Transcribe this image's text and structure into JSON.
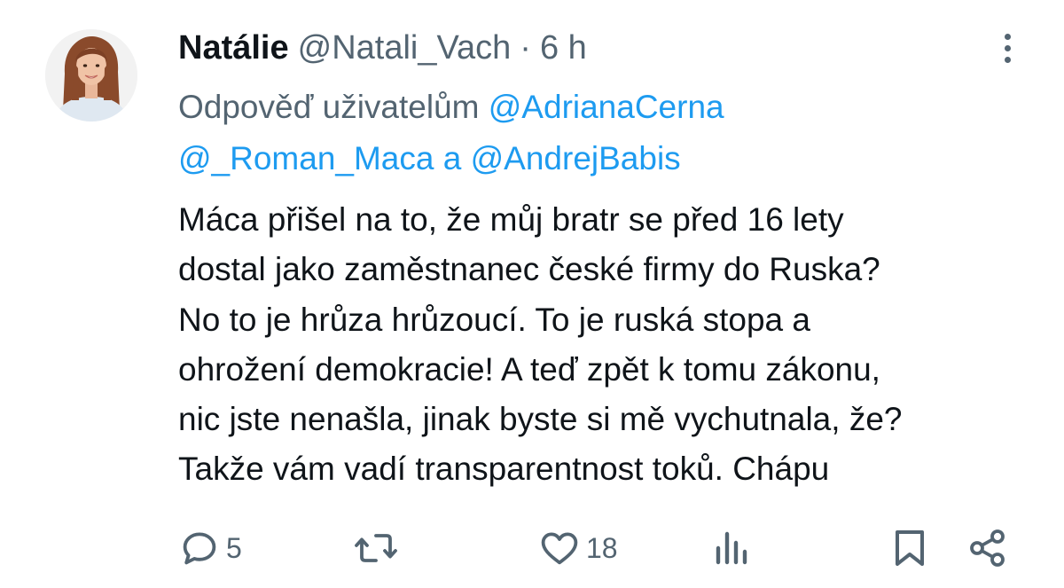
{
  "tweet": {
    "display_name": "Natálie",
    "handle": "@Natali_Vach",
    "separator": "·",
    "time": "6 h",
    "replying_prefix": "Odpověď uživatelům",
    "mention_1": "@AdrianaCerna",
    "mention_2": "@_Roman_Maca",
    "replying_conjunction": "a",
    "mention_3": "@AndrejBabis",
    "body_lines": [
      "Máca přišel na to, že můj bratr se před 16 lety",
      "dostal jako zaměstnanec české firmy do Ruska?",
      "No to je hrůza hrůzoucí. To je ruská stopa a",
      "ohrožení demokracie! A teď zpět k tomu zákonu,",
      "nic jste nenašla, jinak byste si mě vychutnala, že?",
      "Takže vám vadí transparentnost toků. Chápu"
    ]
  },
  "actions": {
    "reply_count": "5",
    "retweet_count": "",
    "like_count": "18",
    "reply_icon": "reply-icon",
    "retweet_icon": "retweet-icon",
    "like_icon": "heart-icon",
    "views_icon": "views-icon",
    "bookmark_icon": "bookmark-icon",
    "share_icon": "share-icon"
  },
  "colors": {
    "text": "#0f1419",
    "secondary": "#536471",
    "link": "#1d9bf0",
    "background": "#ffffff"
  }
}
